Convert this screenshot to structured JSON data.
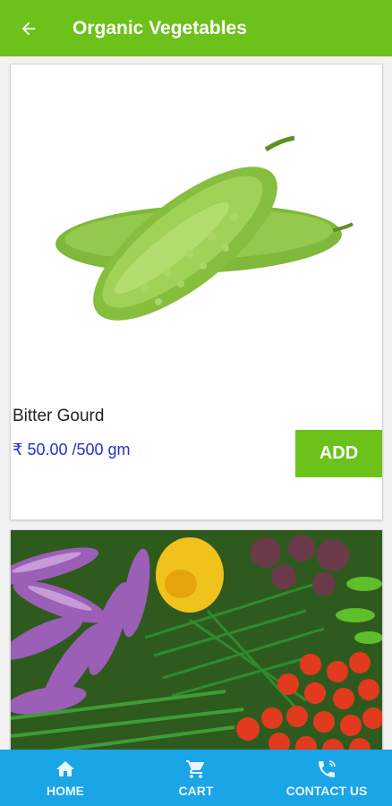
{
  "appbar": {
    "title": "Organic Vegetables",
    "back_icon": "arrow-left-icon"
  },
  "product": {
    "name": "Bitter Gourd",
    "price": "₹ 50.00 /500 gm",
    "add_label": "ADD"
  },
  "bottom_nav": {
    "items": [
      {
        "label": "HOME",
        "icon": "home-icon"
      },
      {
        "label": "CART",
        "icon": "cart-icon"
      },
      {
        "label": "CONTACT US",
        "icon": "phone-icon"
      }
    ]
  },
  "colors": {
    "primary_green": "#6cc21a",
    "nav_blue": "#1aa5e6",
    "price_blue": "#2233cc"
  }
}
